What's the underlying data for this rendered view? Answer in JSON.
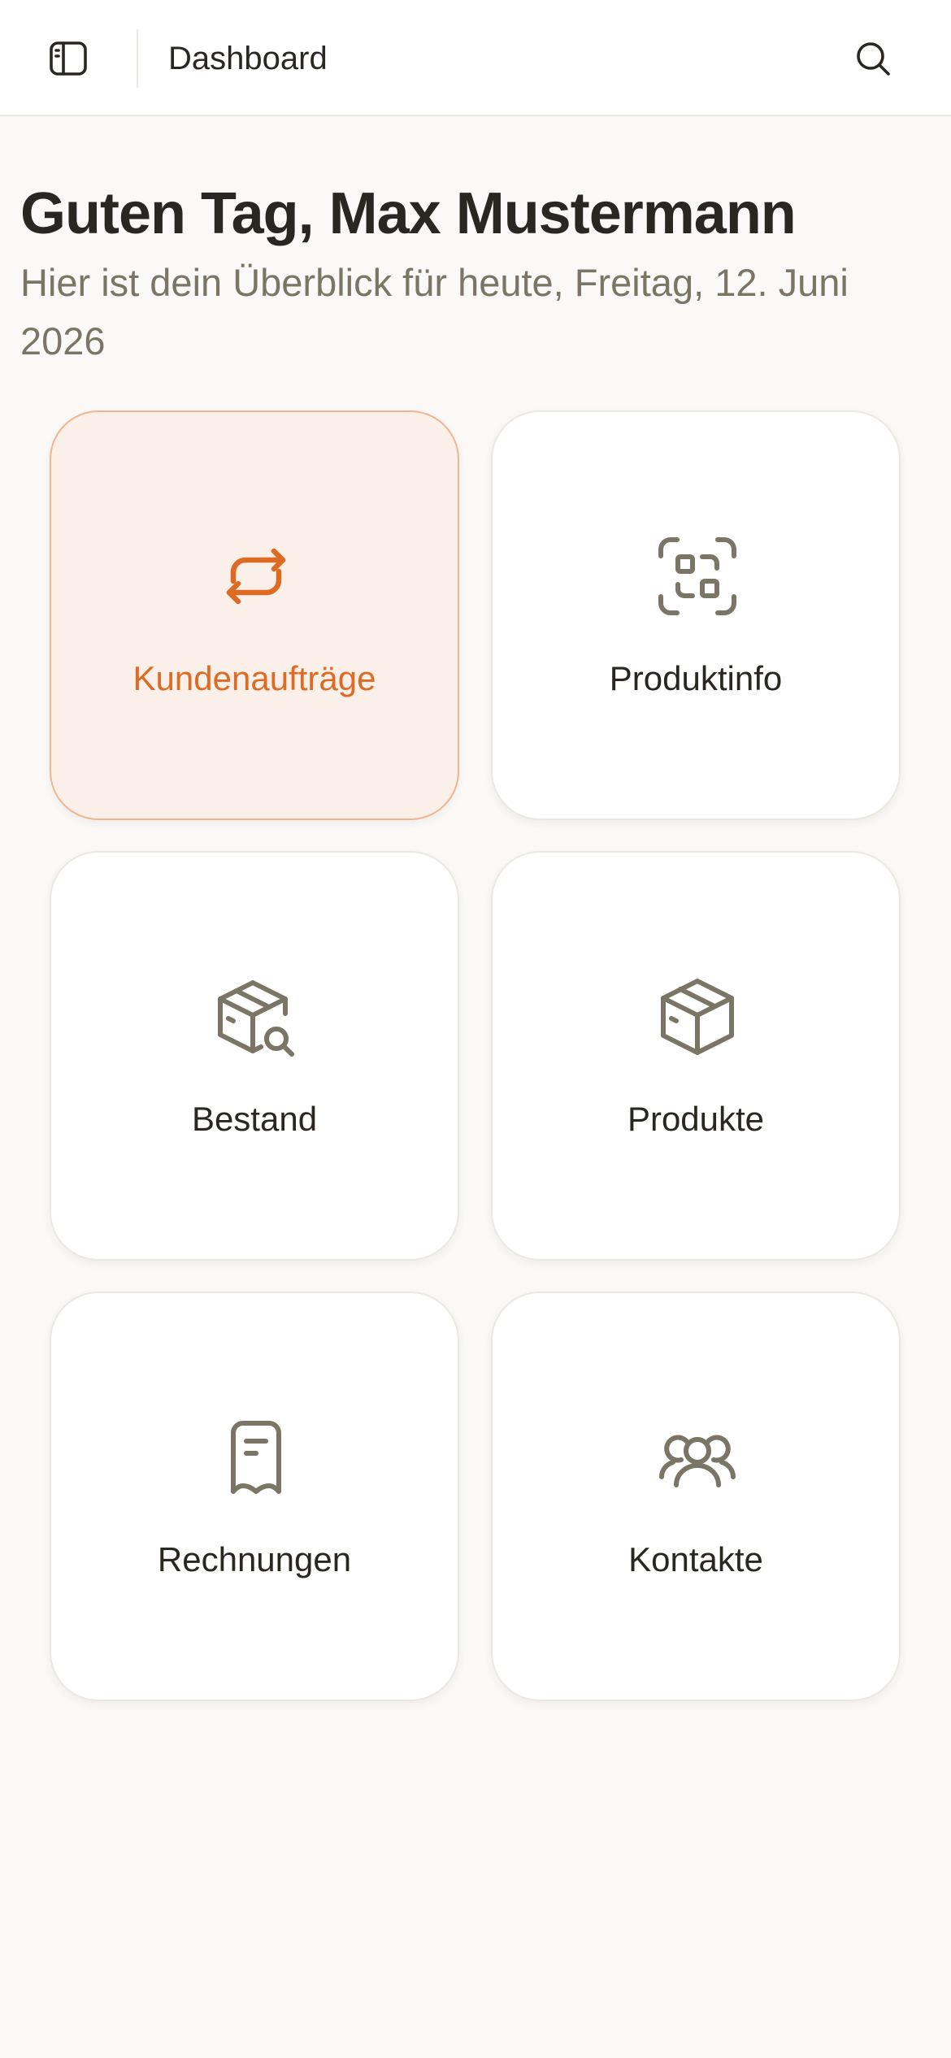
{
  "header": {
    "title": "Dashboard",
    "icons": {
      "sidebar_toggle": "sidebar-panel-icon",
      "search": "search-icon"
    }
  },
  "welcome": {
    "greeting": "Guten Tag, Max Mustermann",
    "subtitle": "Hier ist dein Überblick für heute, Freitag, 12. Juni 2026"
  },
  "tiles": [
    {
      "label": "Kundenaufträge",
      "icon": "repeat-arrows-icon",
      "active": true
    },
    {
      "label": "Produktinfo",
      "icon": "scan-code-icon",
      "active": false
    },
    {
      "label": "Bestand",
      "icon": "package-search-icon",
      "active": false
    },
    {
      "label": "Produkte",
      "icon": "package-icon",
      "active": false
    },
    {
      "label": "Rechnungen",
      "icon": "receipt-icon",
      "active": false
    },
    {
      "label": "Kontakte",
      "icon": "users-icon",
      "active": false
    }
  ],
  "colors": {
    "accent": "#dd6b24",
    "icon_muted": "#7b7565",
    "text": "#2a2622",
    "active_tile_bg": "#fbefe9",
    "active_tile_border": "#efb58f",
    "background": "#faf9f7"
  }
}
